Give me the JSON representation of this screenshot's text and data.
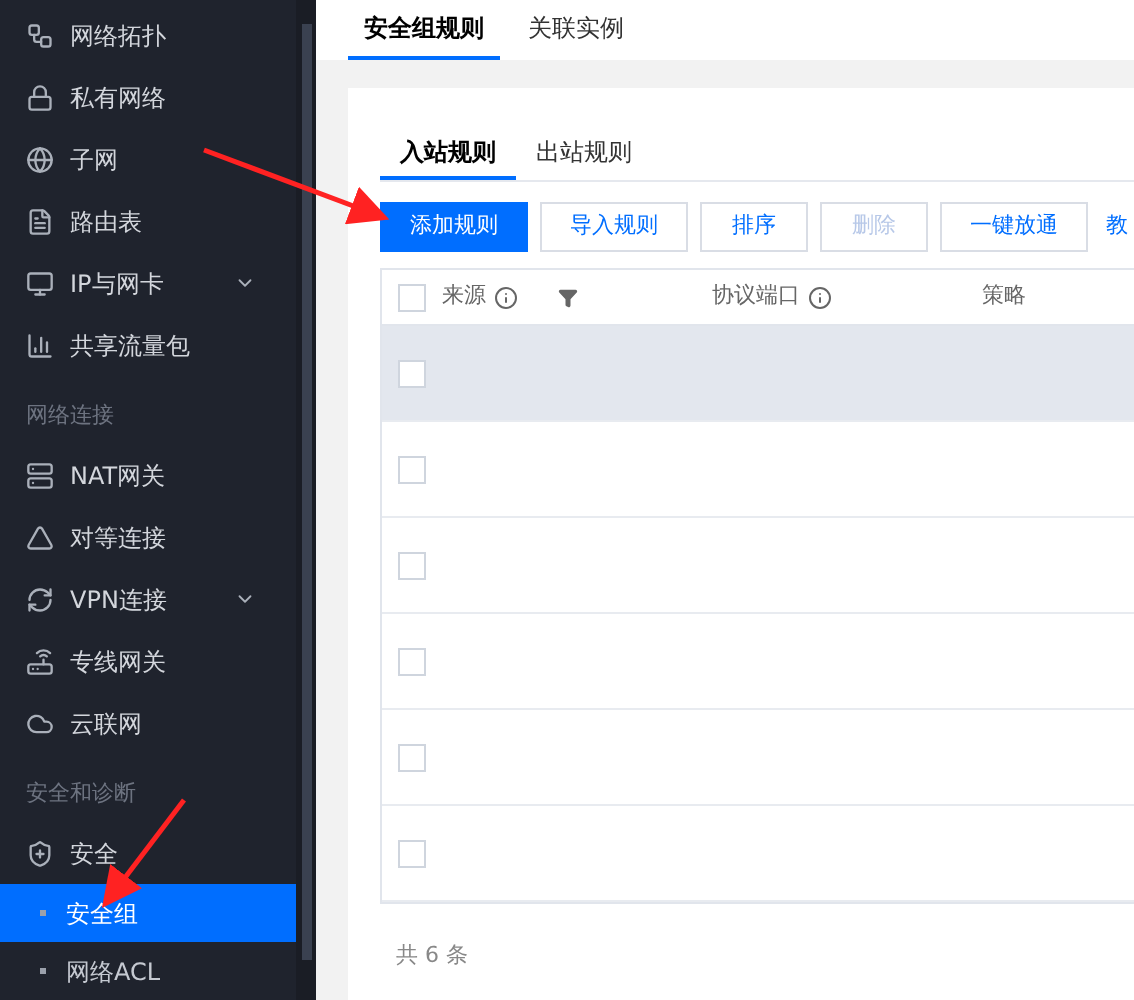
{
  "sidebar": {
    "items": [
      {
        "kind": "item",
        "label": "网络拓扑",
        "selected": false,
        "expandable": false
      },
      {
        "kind": "item",
        "label": "私有网络",
        "selected": false,
        "expandable": false
      },
      {
        "kind": "item",
        "label": "子网",
        "selected": false,
        "expandable": false
      },
      {
        "kind": "item",
        "label": "路由表",
        "selected": false,
        "expandable": false
      },
      {
        "kind": "item",
        "label": "IP与网卡",
        "selected": false,
        "expandable": true
      },
      {
        "kind": "item",
        "label": "共享流量包",
        "selected": false,
        "expandable": false
      },
      {
        "kind": "section",
        "label": "网络连接"
      },
      {
        "kind": "item",
        "label": "NAT网关",
        "selected": false,
        "expandable": false
      },
      {
        "kind": "item",
        "label": "对等连接",
        "selected": false,
        "expandable": false
      },
      {
        "kind": "item",
        "label": "VPN连接",
        "selected": false,
        "expandable": true
      },
      {
        "kind": "item",
        "label": "专线网关",
        "selected": false,
        "expandable": false
      },
      {
        "kind": "item",
        "label": "云联网",
        "selected": false,
        "expandable": false
      },
      {
        "kind": "section",
        "label": "安全和诊断"
      },
      {
        "kind": "item",
        "label": "安全",
        "selected": false,
        "expandable": false
      },
      {
        "kind": "subitem",
        "label": "安全组",
        "selected": true
      },
      {
        "kind": "subitem",
        "label": "网络ACL",
        "selected": false
      }
    ]
  },
  "tabs": [
    {
      "label": "安全组规则",
      "selected": true
    },
    {
      "label": "关联实例",
      "selected": false
    }
  ],
  "subtabs": [
    {
      "label": "入站规则",
      "selected": true
    },
    {
      "label": "出站规则",
      "selected": false
    }
  ],
  "buttons": [
    {
      "label": "添加规则",
      "kind": "primary"
    },
    {
      "label": "导入规则",
      "kind": "default",
      "disabled": false
    },
    {
      "label": "排序",
      "kind": "default",
      "disabled": false
    },
    {
      "label": "删除",
      "kind": "default",
      "disabled": true
    },
    {
      "label": "一键放通",
      "kind": "default",
      "disabled": false
    },
    {
      "label": "教",
      "kind": "link"
    }
  ],
  "table": {
    "columns": [
      {
        "kind": "checkbox",
        "checked": false
      },
      {
        "kind": "text",
        "label": "来源",
        "info": true
      },
      {
        "kind": "filter"
      },
      {
        "kind": "text",
        "label": "协议端口",
        "info": true
      },
      {
        "kind": "text",
        "label": "策略",
        "info": false
      }
    ],
    "rows": [
      {
        "checked": false,
        "highlighted": true
      },
      {
        "checked": false,
        "highlighted": false
      },
      {
        "checked": false,
        "highlighted": false
      },
      {
        "checked": false,
        "highlighted": false
      },
      {
        "checked": false,
        "highlighted": false
      },
      {
        "checked": false,
        "highlighted": false
      }
    ]
  },
  "footer": {
    "total": "共 6 条"
  }
}
